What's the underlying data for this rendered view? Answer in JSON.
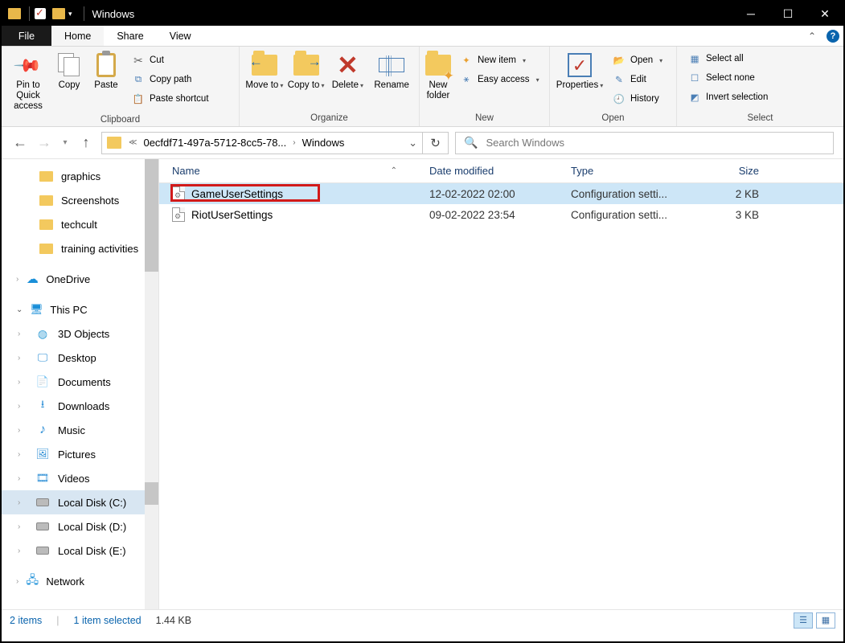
{
  "window": {
    "title": "Windows"
  },
  "tabs": {
    "file": "File",
    "home": "Home",
    "share": "Share",
    "view": "View"
  },
  "ribbon": {
    "clipboard": {
      "label": "Clipboard",
      "pin": "Pin to Quick access",
      "copy": "Copy",
      "paste": "Paste",
      "cut": "Cut",
      "copypath": "Copy path",
      "pasteshortcut": "Paste shortcut"
    },
    "organize": {
      "label": "Organize",
      "moveto": "Move to",
      "copyto": "Copy to",
      "delete": "Delete",
      "rename": "Rename"
    },
    "new": {
      "label": "New",
      "newfolder": "New folder",
      "newitem": "New item",
      "easyaccess": "Easy access"
    },
    "open": {
      "label": "Open",
      "properties": "Properties",
      "open": "Open",
      "edit": "Edit",
      "history": "History"
    },
    "select": {
      "label": "Select",
      "selectall": "Select all",
      "selectnone": "Select none",
      "invert": "Invert selection"
    }
  },
  "address": {
    "seg1": "0ecfdf71-497a-5712-8cc5-78...",
    "seg2": "Windows",
    "search_placeholder": "Search Windows"
  },
  "sidebar": {
    "quick": [
      "graphics",
      "Screenshots",
      "techcult",
      "training activities"
    ],
    "onedrive": "OneDrive",
    "thispc": "This PC",
    "pcitems": [
      "3D Objects",
      "Desktop",
      "Documents",
      "Downloads",
      "Music",
      "Pictures",
      "Videos",
      "Local Disk (C:)",
      "Local Disk (D:)",
      "Local Disk (E:)"
    ],
    "network": "Network"
  },
  "columns": {
    "name": "Name",
    "date": "Date modified",
    "type": "Type",
    "size": "Size"
  },
  "files": [
    {
      "name": "GameUserSettings",
      "date": "12-02-2022 02:00",
      "type": "Configuration setti...",
      "size": "2 KB",
      "selected": true,
      "highlight": true
    },
    {
      "name": "RiotUserSettings",
      "date": "09-02-2022 23:54",
      "type": "Configuration setti...",
      "size": "3 KB",
      "selected": false,
      "highlight": false
    }
  ],
  "status": {
    "items": "2 items",
    "selected": "1 item selected",
    "size": "1.44 KB"
  }
}
